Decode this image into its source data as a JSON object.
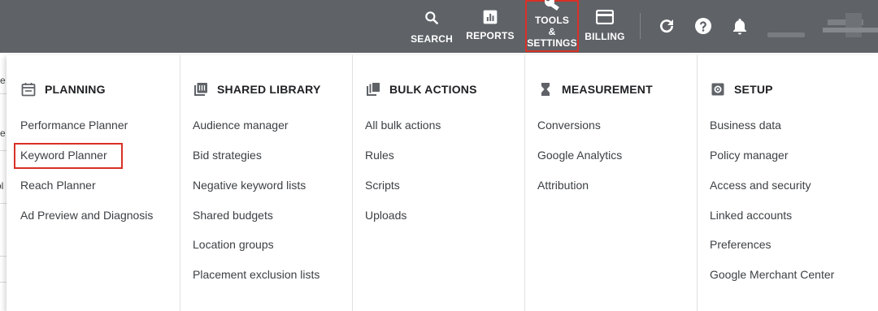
{
  "topbar": {
    "search_label": "SEARCH",
    "reports_label": "REPORTS",
    "tools_label_1": "TOOLS",
    "tools_label_2": "&",
    "tools_label_3": "SETTINGS",
    "billing_label": "BILLING",
    "icons": [
      "search-icon",
      "reports-icon",
      "wrench-icon",
      "billing-card-icon",
      "refresh-icon",
      "help-icon",
      "bell-icon"
    ]
  },
  "menu": {
    "columns": [
      {
        "title": "PLANNING",
        "icon": "planning-icon",
        "items": [
          "Performance Planner",
          "Keyword Planner",
          "Reach Planner",
          "Ad Preview and Diagnosis"
        ]
      },
      {
        "title": "SHARED LIBRARY",
        "icon": "shared-library-icon",
        "items": [
          "Audience manager",
          "Bid strategies",
          "Negative keyword lists",
          "Shared budgets",
          "Location groups",
          "Placement exclusion lists"
        ]
      },
      {
        "title": "BULK ACTIONS",
        "icon": "bulk-actions-icon",
        "items": [
          "All bulk actions",
          "Rules",
          "Scripts",
          "Uploads"
        ]
      },
      {
        "title": "MEASUREMENT",
        "icon": "hourglass-icon",
        "items": [
          "Conversions",
          "Google Analytics",
          "Attribution"
        ]
      },
      {
        "title": "SETUP",
        "icon": "setup-icon",
        "items": [
          "Business data",
          "Policy manager",
          "Access and security",
          "Linked accounts",
          "Preferences",
          "Google Merchant Center"
        ]
      }
    ]
  },
  "left_fragments": [
    "e",
    "e",
    "ol"
  ],
  "colors": {
    "topbar": "#5f6368",
    "highlight": "#d93025",
    "text": "#3c4043"
  }
}
